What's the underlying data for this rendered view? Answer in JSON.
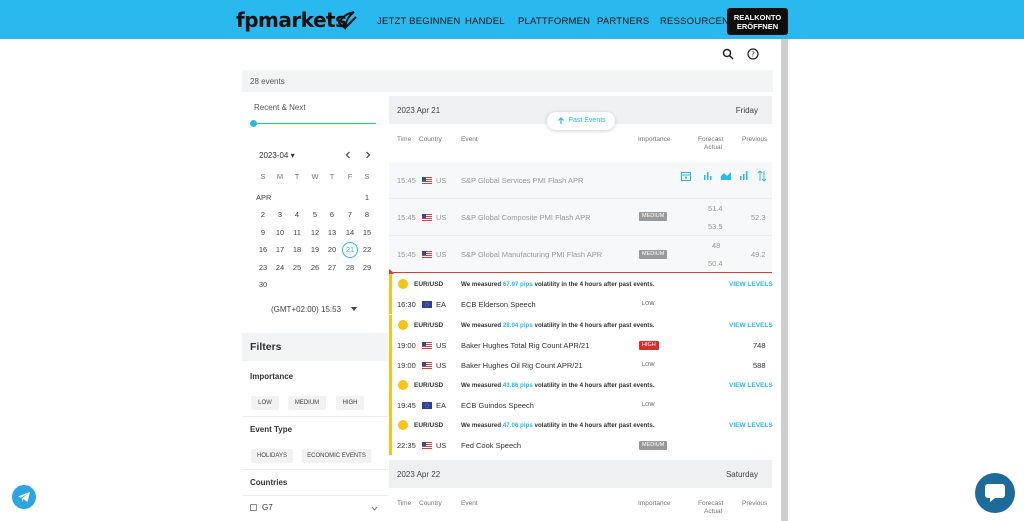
{
  "header": {
    "logo": "fpmarkets",
    "nav": [
      "JETZT BEGINNEN",
      "HANDEL",
      "PLATTFORMEN",
      "PARTNERS",
      "RESSOURCEN"
    ],
    "cta_line1": "REALKONTO",
    "cta_line2": "ERÖFFNEN"
  },
  "widget": {
    "events_count": "28 events",
    "range_label": "Recent & Next",
    "calendar": {
      "month_label": "2023-04 ▾",
      "weekdays": [
        "S",
        "M",
        "T",
        "W",
        "T",
        "F",
        "S"
      ],
      "month_abbrev": "APR",
      "weeks": [
        [
          "",
          "",
          "",
          "",
          "",
          "",
          "1"
        ],
        [
          "2",
          "3",
          "4",
          "5",
          "6",
          "7",
          "8"
        ],
        [
          "9",
          "10",
          "11",
          "12",
          "13",
          "14",
          "15"
        ],
        [
          "16",
          "17",
          "18",
          "19",
          "20",
          "21",
          "22"
        ],
        [
          "23",
          "24",
          "25",
          "26",
          "27",
          "28",
          "29"
        ],
        [
          "30",
          "",
          "",
          "",
          "",
          "",
          ""
        ]
      ],
      "selected_day": "21"
    },
    "timezone": "(GMT+02:00) 15:53",
    "filters": {
      "title": "Filters",
      "importance_title": "Importance",
      "importance": [
        "LOW",
        "MEDIUM",
        "HIGH"
      ],
      "event_type_title": "Event Type",
      "event_types": [
        "HOLIDAYS",
        "ECONOMIC EVENTS"
      ],
      "countries_title": "Countries",
      "country_option": "G7"
    },
    "past_events_label": "Past Events",
    "columns": {
      "time": "Time",
      "country": "Country",
      "event": "Event",
      "importance": "Importance",
      "forecast": "Forecast",
      "actual": "Actual",
      "previous": "Previous"
    },
    "day1": {
      "date": "2023 Apr 21",
      "weekday": "Friday"
    },
    "day2": {
      "date": "2023 Apr 22",
      "weekday": "Saturday"
    },
    "past_rows": [
      {
        "time": "15:45",
        "country": "US",
        "event": "S&P Global Services PMI Flash APR"
      },
      {
        "time": "15:45",
        "country": "US",
        "event": "S&P Global Composite PMI Flash APR",
        "importance": "MEDIUM",
        "forecast": "51.4",
        "actual": "53.5",
        "previous": "52.3"
      },
      {
        "time": "15:45",
        "country": "US",
        "event": "S&P Global Manufacturing PMI Flash APR",
        "importance": "MEDIUM",
        "forecast": "48",
        "actual": "50.4",
        "previous": "49.2"
      }
    ],
    "volatility": [
      {
        "pair": "EUR/USD",
        "pips": "67.97 pips",
        "action": "VIEW LEVELS"
      },
      {
        "pair": "EUR/USD",
        "pips": "28.04 pips",
        "action": "VIEW LEVELS"
      },
      {
        "pair": "EUR/USD",
        "pips": "43.86 pips",
        "action": "VIEW LEVELS"
      },
      {
        "pair": "EUR/USD",
        "pips": "47.06 pips",
        "action": "VIEW LEVELS"
      }
    ],
    "vol_prefix": "We measured",
    "vol_suffix": "volatility in the 4 hours after past events.",
    "upcoming": [
      {
        "time": "16:30",
        "country": "EA",
        "event": "ECB Elderson Speech",
        "importance": "LOW"
      },
      {
        "time": "19:00",
        "country": "US",
        "event": "Baker Hughes Total Rig Count APR/21",
        "importance": "HIGH",
        "previous": "748"
      },
      {
        "time": "19:00",
        "country": "US",
        "event": "Baker Hughes Oil Rig Count APR/21",
        "importance": "LOW",
        "previous": "588"
      },
      {
        "time": "19:45",
        "country": "EA",
        "event": "ECB Guindos Speech",
        "importance": "LOW"
      },
      {
        "time": "22:35",
        "country": "US",
        "event": "Fed Cook Speech",
        "importance": "MEDIUM"
      }
    ]
  },
  "colors": {
    "brand": "#2ab9ee",
    "volatility": "#f5c518",
    "high": "#d32f2f"
  }
}
